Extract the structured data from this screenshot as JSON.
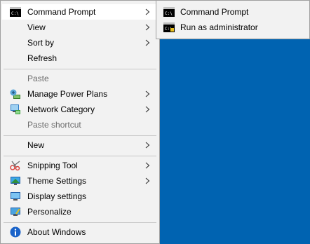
{
  "context_menu": {
    "items": [
      {
        "label": "Command Prompt",
        "icon": "cmd-icon",
        "submenu": true,
        "highlighted": true
      },
      {
        "label": "View",
        "submenu": true
      },
      {
        "label": "Sort by",
        "submenu": true
      },
      {
        "label": "Refresh"
      },
      {
        "label": "Paste",
        "disabled": true
      },
      {
        "label": "Manage Power Plans",
        "icon": "power-plan-icon",
        "submenu": true
      },
      {
        "label": "Network Category",
        "icon": "network-icon",
        "submenu": true
      },
      {
        "label": "Paste shortcut",
        "disabled": true
      },
      {
        "label": "New",
        "submenu": true
      },
      {
        "label": "Snipping Tool",
        "icon": "scissors-icon",
        "submenu": true
      },
      {
        "label": "Theme Settings",
        "icon": "theme-icon",
        "submenu": true
      },
      {
        "label": "Display settings",
        "icon": "display-icon"
      },
      {
        "label": "Personalize",
        "icon": "personalize-icon"
      },
      {
        "label": "About Windows",
        "icon": "info-icon"
      }
    ]
  },
  "submenu": {
    "items": [
      {
        "label": "Command Prompt",
        "icon": "cmd-icon"
      },
      {
        "label": "Run as administrator",
        "icon": "cmd-admin-icon"
      }
    ]
  },
  "colors": {
    "desktop": "#0063b1",
    "menu_bg": "#f2f2f2",
    "highlight": "#ffffff",
    "disabled_text": "#6d6d6d"
  }
}
